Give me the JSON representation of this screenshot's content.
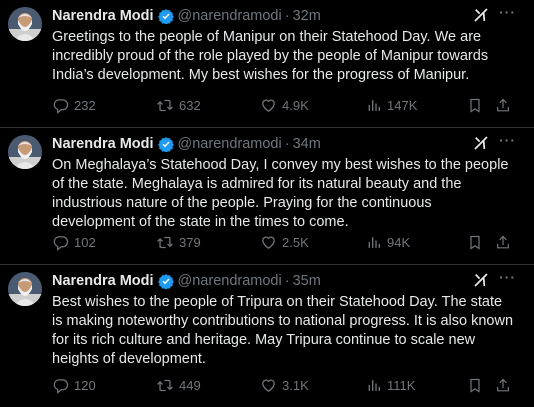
{
  "tweets": [
    {
      "author": "Narendra Modi",
      "handle": "@narendramodi",
      "separator": "·",
      "time": "32m",
      "text": "Greetings to the people of Manipur on their Statehood Day. We are incredibly proud of the role played by the people of Manipur towards India’s development. My best wishes for the progress of Manipur.",
      "replies": "232",
      "retweets": "632",
      "likes": "4.9K",
      "views": "147K"
    },
    {
      "author": "Narendra Modi",
      "handle": "@narendramodi",
      "separator": "·",
      "time": "34m",
      "text": "On Meghalaya’s Statehood Day, I convey my best wishes to the people of the state. Meghalaya is admired for its natural beauty and the industrious nature of the people. Praying for the continuous development of the state in the times to come.",
      "replies": "102",
      "retweets": "379",
      "likes": "2.5K",
      "views": "94K"
    },
    {
      "author": "Narendra Modi",
      "handle": "@narendramodi",
      "separator": "·",
      "time": "35m",
      "text": "Best wishes to the people of Tripura on their Statehood Day. The state is making noteworthy contributions to national progress. It is also known for its rich culture and heritage. May Tripura continue to scale new heights of development.",
      "replies": "120",
      "retweets": "449",
      "likes": "3.1K",
      "views": "111K"
    }
  ],
  "more_icon": "···",
  "icons": [
    "verified-badge-icon",
    "grok-icon",
    "more-icon",
    "reply-icon",
    "retweet-icon",
    "like-icon",
    "views-icon",
    "bookmark-icon",
    "share-icon"
  ],
  "colors": {
    "background": "#000000",
    "text": "#e7e9ea",
    "muted": "#71767b",
    "verified": "#1d9bf0",
    "divider": "#2f3336"
  }
}
